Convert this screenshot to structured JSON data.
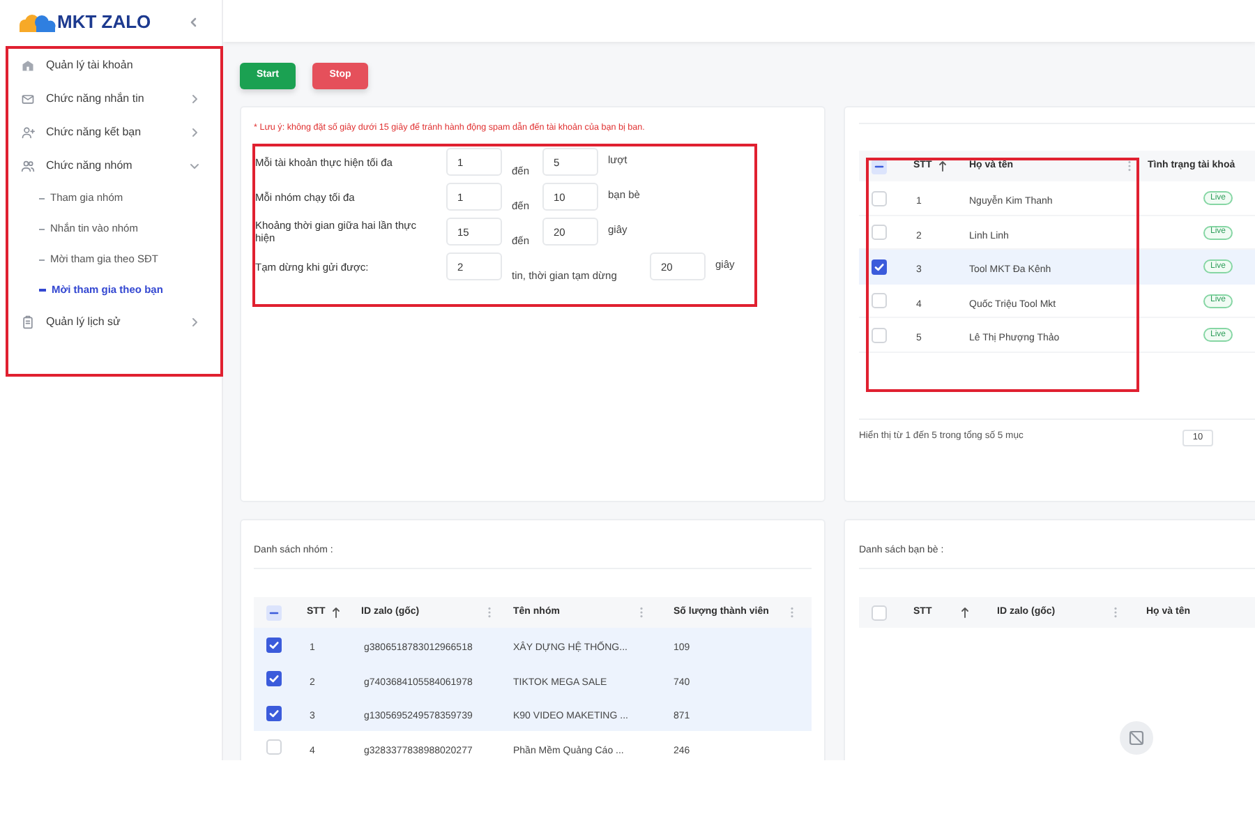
{
  "logo": {
    "text": "MKT ZALO"
  },
  "sidebar": {
    "highlighted": true,
    "items": [
      {
        "label": "Quản lý tài khoản",
        "kind": "link",
        "selected": false
      },
      {
        "label": "Chức năng nhắn tin",
        "kind": "menu",
        "expanded": false,
        "selected": false
      },
      {
        "label": "Chức năng kết bạn",
        "kind": "menu",
        "expanded": false,
        "selected": false
      },
      {
        "label": "Chức năng nhóm",
        "kind": "menu",
        "expanded": true,
        "selected": false,
        "children": [
          {
            "label": "Tham gia nhóm",
            "selected": false
          },
          {
            "label": "Nhắn tin vào nhóm",
            "selected": false
          },
          {
            "label": "Mời tham gia theo SĐT",
            "selected": false
          },
          {
            "label": "Mời tham gia theo bạn",
            "selected": true
          }
        ]
      },
      {
        "label": "Quản lý lịch sử",
        "kind": "menu",
        "expanded": false,
        "selected": false
      }
    ]
  },
  "toolbar": {
    "buttons": [
      {
        "label": "Start",
        "kind": "start"
      },
      {
        "label": "Stop",
        "kind": "stop"
      }
    ]
  },
  "settings": {
    "note": "* Lưu ý: không đặt số giây dưới 15 giây để tránh hành động spam dẫn đến tài khoản của bạn bị ban.",
    "highlighted": true,
    "rows": [
      {
        "kind": "range",
        "label": "Mỗi tài khoản thực hiện tối đa",
        "from": "1",
        "separator": "đến",
        "to": "5",
        "unit": "lượt"
      },
      {
        "kind": "range",
        "label": "Mỗi nhóm chạy tối đa",
        "from": "1",
        "separator": "đến",
        "to": "10",
        "unit": "bạn bè"
      },
      {
        "kind": "range",
        "label": "Khoảng thời gian giữa hai lần thực hiện",
        "from": "15",
        "separator": "đến",
        "to": "20",
        "unit": "giây"
      },
      {
        "kind": "pause",
        "label": "Tạm dừng khi gửi được:",
        "from": "2",
        "separator": "tin, thời gian tạm dừng",
        "to": "20",
        "unit": "giây"
      }
    ]
  },
  "accounts": {
    "highlighted": true,
    "header_checked": false,
    "header_indeterminate": true,
    "columns": [
      {
        "label": "STT",
        "sorted": true,
        "menu": false
      },
      {
        "label": "Họ và tên",
        "sorted": false,
        "menu": true
      },
      {
        "label": "Tình trạng tài khoả",
        "sorted": false,
        "menu": false
      }
    ],
    "rows": [
      {
        "cells": [
          "1",
          "Nguyễn Kim Thanh"
        ],
        "status": "Live",
        "selected": false
      },
      {
        "cells": [
          "2",
          "Linh Linh"
        ],
        "status": "Live",
        "selected": false
      },
      {
        "cells": [
          "3",
          "Tool MKT Đa Kênh"
        ],
        "status": "Live",
        "selected": true
      },
      {
        "cells": [
          "4",
          "Quốc Triệu Tool Mkt"
        ],
        "status": "Live",
        "selected": false
      },
      {
        "cells": [
          "5",
          "Lê Thị Phượng Thảo"
        ],
        "status": "Live",
        "selected": false
      }
    ],
    "summary": "Hiển thị từ 1 đến 5 trong tổng số 5 mục",
    "page_size": "10"
  },
  "groups": {
    "title": "Danh sách nhóm :",
    "header_checked": false,
    "header_indeterminate": true,
    "columns": [
      {
        "label": "STT",
        "sorted": true,
        "menu": false
      },
      {
        "label": "ID zalo (gốc)",
        "sorted": false,
        "menu": true
      },
      {
        "label": "Tên nhóm",
        "sorted": false,
        "menu": true
      },
      {
        "label": "Số lượng thành viên",
        "sorted": false,
        "menu": true
      }
    ],
    "rows": [
      {
        "cells": [
          "1",
          "g3806518783012966518",
          "XÂY DỰNG HỆ THỐNG...",
          "109"
        ],
        "selected": true
      },
      {
        "cells": [
          "2",
          "g7403684105584061978",
          "TIKTOK MEGA SALE",
          "740"
        ],
        "selected": true
      },
      {
        "cells": [
          "3",
          "g1305695249578359739",
          "K90 VIDEO MAKETING ...",
          "871"
        ],
        "selected": true
      },
      {
        "cells": [
          "4",
          "g3283377838988020277",
          "Phần Mềm Quảng Cáo ...",
          "246"
        ],
        "selected": false
      }
    ]
  },
  "friends": {
    "title": "Danh sách bạn bè :",
    "header_checked": false,
    "header_indeterminate": false,
    "columns": [
      {
        "label": "STT",
        "sorted": true,
        "menu": false
      },
      {
        "label": "ID zalo (gốc)",
        "sorted": false,
        "menu": true
      },
      {
        "label": "Họ và tên",
        "sorted": false,
        "menu": false
      }
    ]
  }
}
